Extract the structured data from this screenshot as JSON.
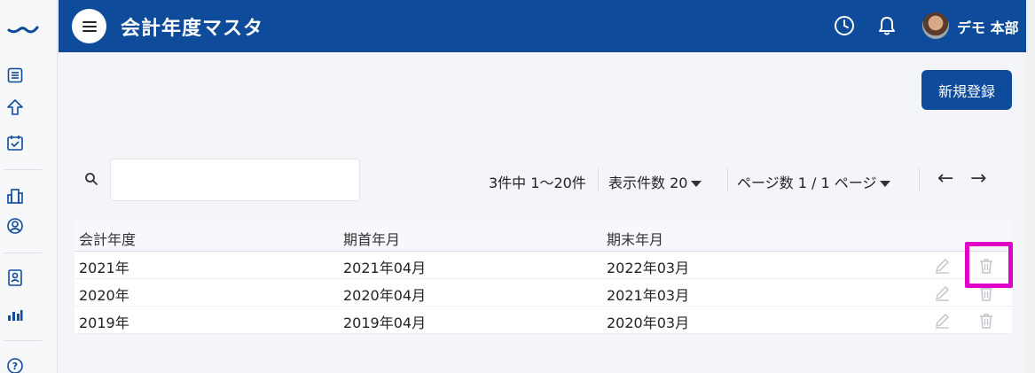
{
  "header": {
    "title": "会計年度マスタ",
    "user_name": "デモ 本部",
    "brand_color": "#0e4b9b"
  },
  "sidebar": {
    "items": [
      {
        "icon": "list-icon"
      },
      {
        "icon": "upload-arrow-icon"
      },
      {
        "icon": "calendar-check-icon"
      },
      {
        "icon": "building-icon"
      },
      {
        "icon": "user-circle-icon"
      },
      {
        "icon": "id-badge-icon"
      },
      {
        "icon": "bar-chart-icon"
      },
      {
        "icon": "help-icon"
      }
    ]
  },
  "toolbar": {
    "new_label": "新規登録",
    "search_placeholder": "",
    "count_text": "3件中 1〜20件",
    "per_page_text": "表示件数 20",
    "page_text": "ページ数 1 / 1 ページ",
    "prev_arrow": "←",
    "next_arrow": "→"
  },
  "table": {
    "headers": [
      "会計年度",
      "期首年月",
      "期末年月"
    ],
    "rows": [
      [
        "2021年",
        "2021年04月",
        "2022年03月"
      ],
      [
        "2020年",
        "2020年04月",
        "2021年03月"
      ],
      [
        "2019年",
        "2019年04月",
        "2020年03月"
      ]
    ]
  },
  "colors": {
    "highlight": "#e000c8",
    "icon_muted": "#bfc3c9"
  }
}
